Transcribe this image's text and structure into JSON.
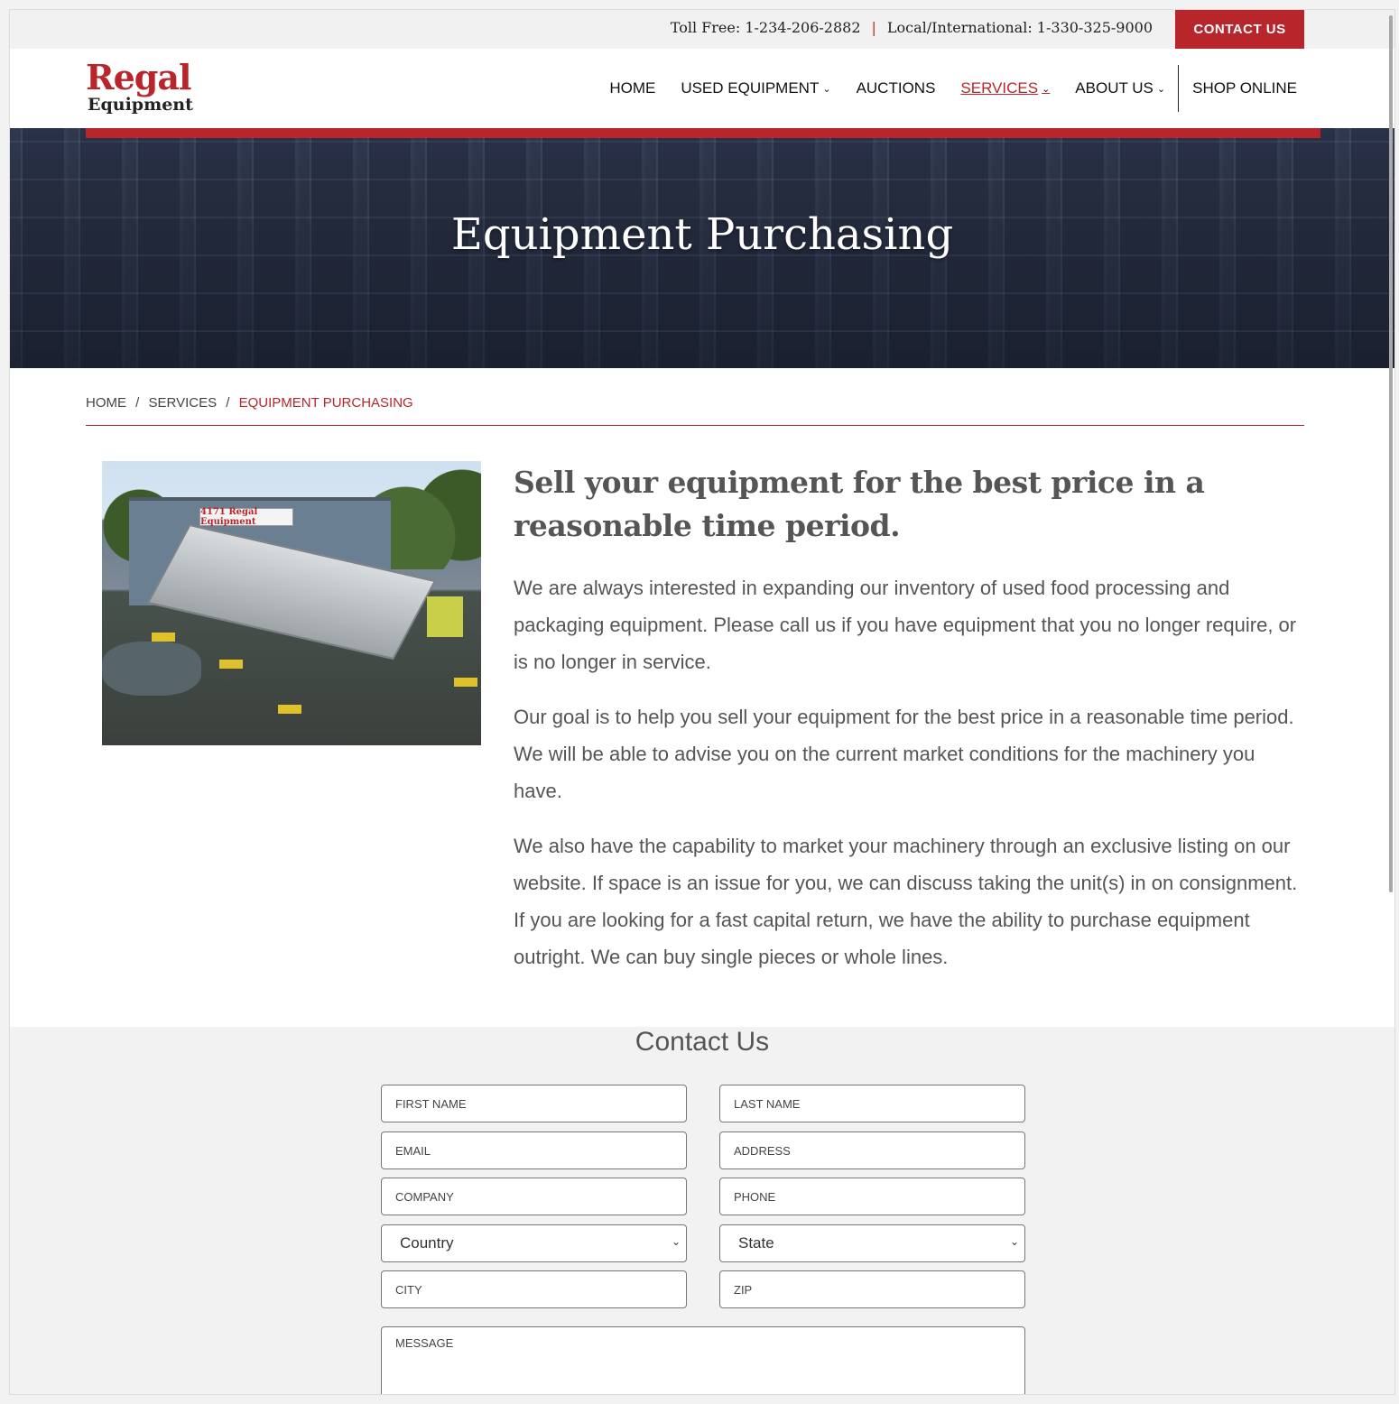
{
  "topbar": {
    "toll_free": "Toll Free: 1-234-206-2882",
    "separator": "|",
    "local": "Local/International: 1-330-325-9000",
    "contact_button": "CONTACT US"
  },
  "logo": {
    "line1": "Regal",
    "line2": "Equipment"
  },
  "nav": {
    "items": [
      {
        "label": "HOME"
      },
      {
        "label": "USED EQUIPMENT"
      },
      {
        "label": "AUCTIONS"
      },
      {
        "label": "SERVICES"
      },
      {
        "label": "ABOUT US"
      },
      {
        "label": "SHOP ONLINE"
      }
    ]
  },
  "hero": {
    "title": "Equipment Purchasing"
  },
  "breadcrumb": {
    "home": "HOME",
    "sep": "/",
    "services": "SERVICES",
    "current": "EQUIPMENT PURCHASING"
  },
  "photo": {
    "sign_text": "4171 Regal Equipment"
  },
  "content": {
    "heading": "Sell your equipment for the best price in a reasonable time period.",
    "paragraphs": [
      "We are always interested in expanding our inventory of used food processing and packaging equipment. Please call us if you have equipment that you no longer require, or is no longer in service.",
      "Our goal is to help you sell your equipment for the best price in a reasonable time period. We will be able to advise you on the current market conditions for the machinery you have.",
      "We also have the capability to market your machinery through an exclusive listing on our website. If space is an issue for you, we can discuss taking the unit(s) in on consignment. If you are looking for a fast capital return, we have the ability to purchase equipment outright. We can buy single pieces or whole lines."
    ]
  },
  "contact": {
    "title": "Contact Us",
    "fields": {
      "first_name": "FIRST NAME",
      "last_name": "LAST NAME",
      "email": "EMAIL",
      "address": "ADDRESS",
      "company": "COMPANY",
      "phone": "PHONE",
      "country": "Country",
      "state": "State",
      "city": "CITY",
      "zip": "ZIP",
      "message": "MESSAGE"
    }
  },
  "colors": {
    "accent": "#b8262b",
    "text": "#555555",
    "topbar_bg": "#f1f1f1"
  }
}
